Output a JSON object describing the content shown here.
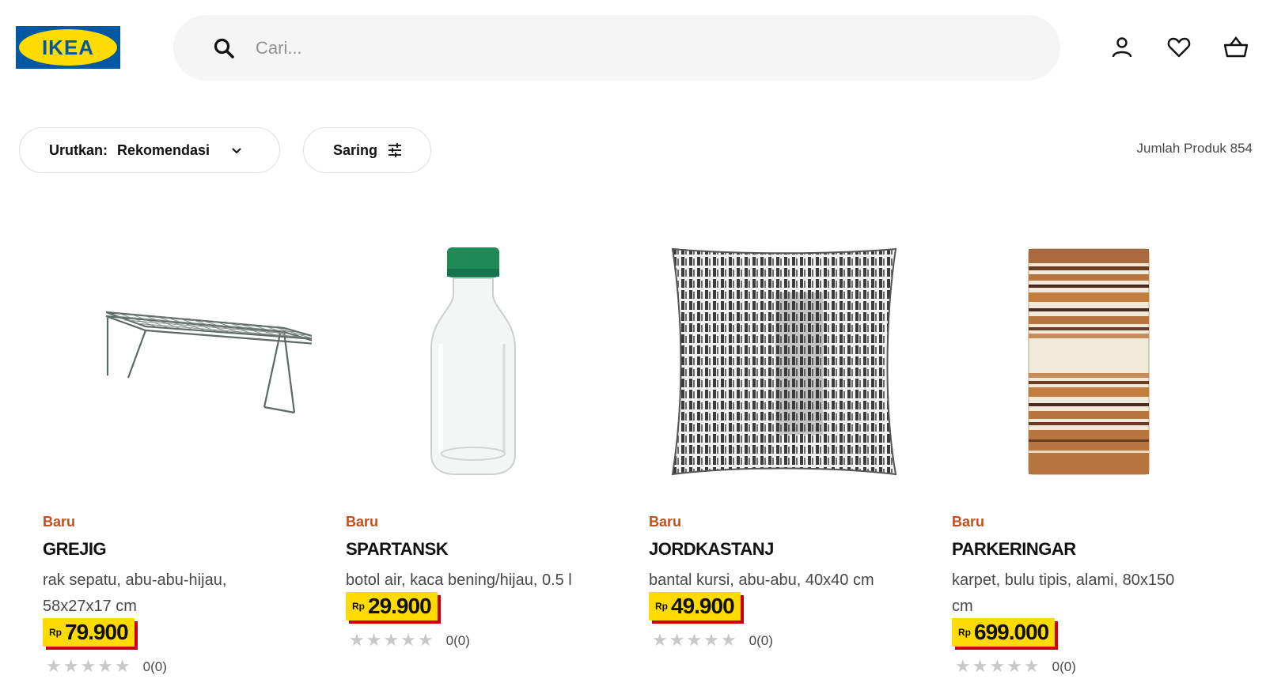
{
  "header": {
    "logo_text": "IKEA",
    "search_placeholder": "Cari...",
    "icons": [
      "search-icon",
      "user-icon",
      "heart-icon",
      "basket-icon"
    ]
  },
  "toolbar": {
    "sort_label": "Urutkan:",
    "sort_value": "Rekomendasi",
    "filter_label": "Saring",
    "product_count": "Jumlah Produk 854"
  },
  "colors": {
    "ikea_blue": "#0058a3",
    "ikea_yellow": "#ffdb00",
    "badge_orange": "#c1501e",
    "price_shadow_red": "#cc0008"
  },
  "products": [
    {
      "badge": "Baru",
      "name": "GREJIG",
      "description": "rak sepatu, abu-abu-hijau, 58x27x17 cm",
      "currency": "Rp",
      "price": "79.900",
      "stars": "★★★★★",
      "rating_count": "0(0)",
      "image": "shoe-rack-image"
    },
    {
      "badge": "Baru",
      "name": "SPARTANSK",
      "description": "botol air, kaca bening/hijau, 0.5 l",
      "currency": "Rp",
      "price": "29.900",
      "stars": "★★★★★",
      "rating_count": "0(0)",
      "image": "water-bottle-image"
    },
    {
      "badge": "Baru",
      "name": "JORDKASTANJ",
      "description": "bantal kursi, abu-abu, 40x40 cm",
      "currency": "Rp",
      "price": "49.900",
      "stars": "★★★★★",
      "rating_count": "0(0)",
      "image": "cushion-image"
    },
    {
      "badge": "Baru",
      "name": "PARKERINGAR",
      "description": "karpet, bulu tipis, alami, 80x150 cm",
      "currency": "Rp",
      "price": "699.000",
      "stars": "★★★★★",
      "rating_count": "0(0)",
      "image": "rug-image"
    }
  ]
}
